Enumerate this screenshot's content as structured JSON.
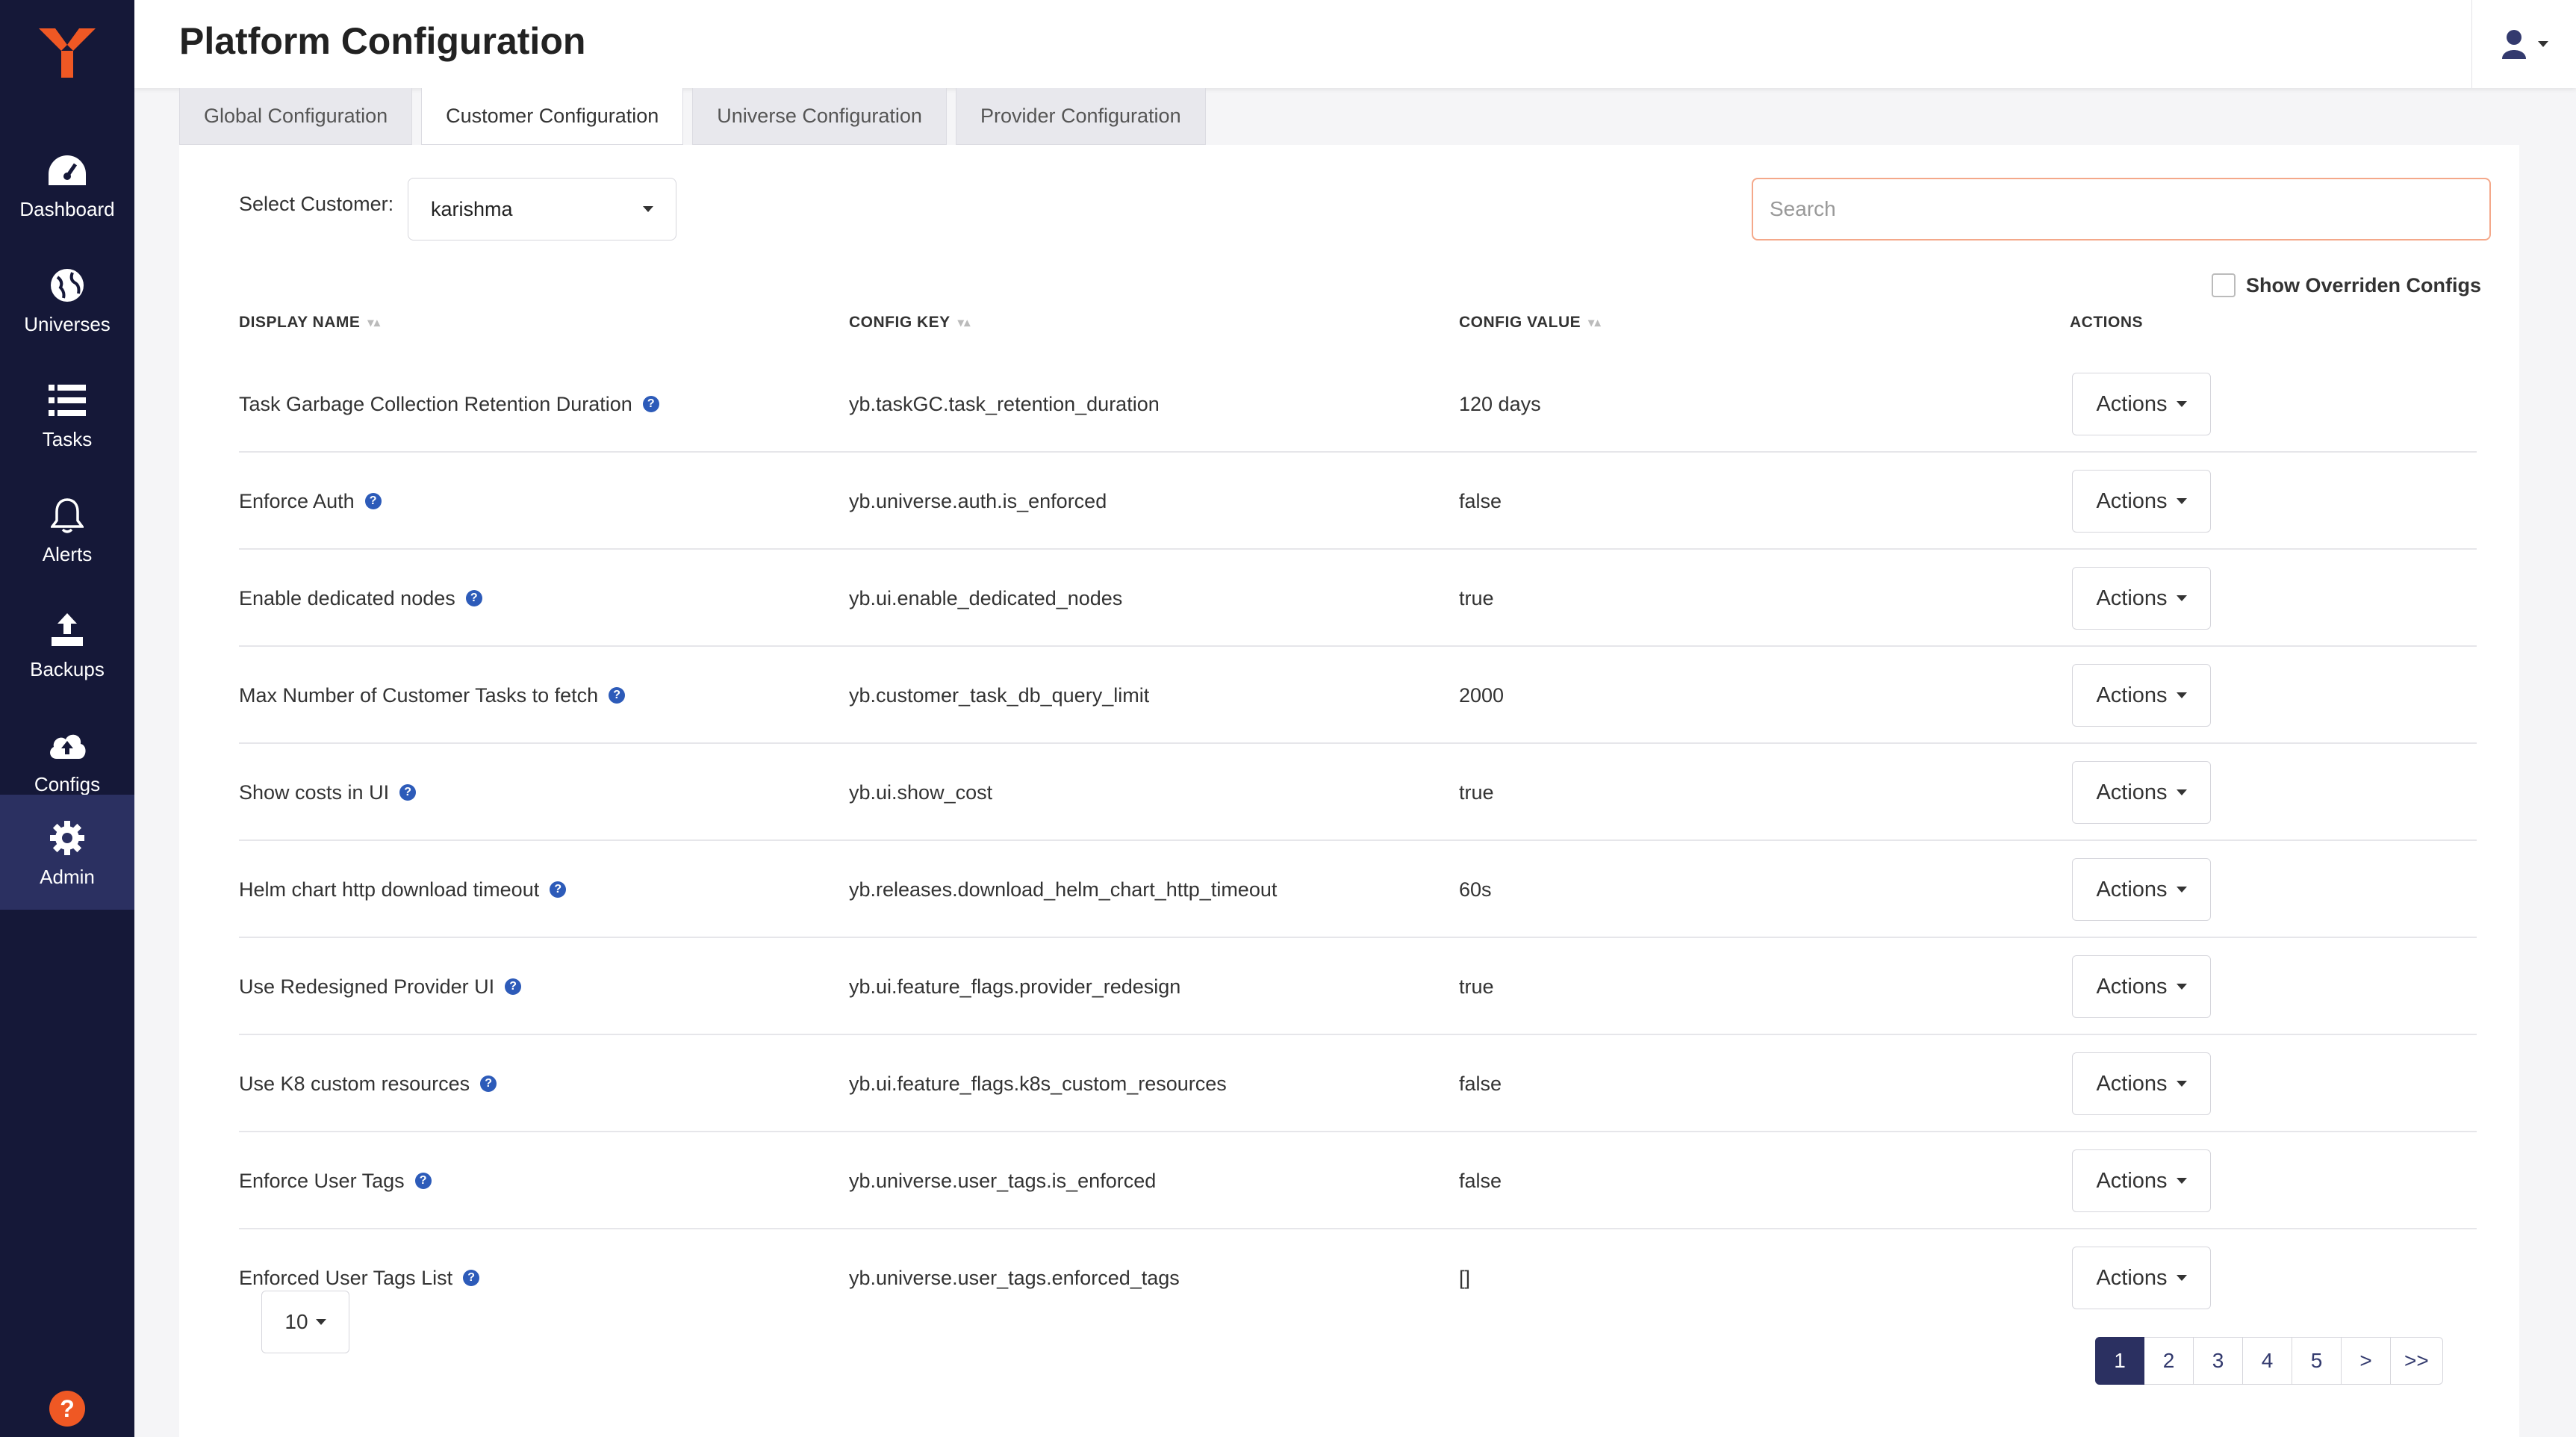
{
  "header": {
    "title": "Platform Configuration"
  },
  "sidebar": {
    "items": [
      {
        "label": "Dashboard",
        "icon": "dashboard-icon"
      },
      {
        "label": "Universes",
        "icon": "globe-icon"
      },
      {
        "label": "Tasks",
        "icon": "list-icon"
      },
      {
        "label": "Alerts",
        "icon": "bell-icon"
      },
      {
        "label": "Backups",
        "icon": "upload-icon"
      },
      {
        "label": "Configs",
        "icon": "cloud-upload-icon"
      },
      {
        "label": "Admin",
        "icon": "gear-icon",
        "active": true
      }
    ],
    "help_glyph": "?"
  },
  "tabs": [
    {
      "label": "Global Configuration"
    },
    {
      "label": "Customer Configuration",
      "active": true
    },
    {
      "label": "Universe Configuration"
    },
    {
      "label": "Provider Configuration"
    }
  ],
  "filters": {
    "customer_label": "Select Customer:",
    "customer_value": "karishma",
    "search_placeholder": "Search",
    "show_overridden_label": "Show Overriden Configs"
  },
  "table": {
    "columns": [
      "DISPLAY NAME",
      "CONFIG KEY",
      "CONFIG VALUE",
      "ACTIONS"
    ],
    "action_label": "Actions",
    "rows": [
      {
        "name": "Task Garbage Collection Retention Duration",
        "key": "yb.taskGC.task_retention_duration",
        "value": "120 days"
      },
      {
        "name": "Enforce Auth",
        "key": "yb.universe.auth.is_enforced",
        "value": "false"
      },
      {
        "name": "Enable dedicated nodes",
        "key": "yb.ui.enable_dedicated_nodes",
        "value": "true"
      },
      {
        "name": "Max Number of Customer Tasks to fetch",
        "key": "yb.customer_task_db_query_limit",
        "value": "2000"
      },
      {
        "name": "Show costs in UI",
        "key": "yb.ui.show_cost",
        "value": "true"
      },
      {
        "name": "Helm chart http download timeout",
        "key": "yb.releases.download_helm_chart_http_timeout",
        "value": "60s"
      },
      {
        "name": "Use Redesigned Provider UI",
        "key": "yb.ui.feature_flags.provider_redesign",
        "value": "true"
      },
      {
        "name": "Use K8 custom resources",
        "key": "yb.ui.feature_flags.k8s_custom_resources",
        "value": "false"
      },
      {
        "name": "Enforce User Tags",
        "key": "yb.universe.user_tags.is_enforced",
        "value": "false"
      },
      {
        "name": "Enforced User Tags List",
        "key": "yb.universe.user_tags.enforced_tags",
        "value": "[]"
      }
    ]
  },
  "pagination": {
    "page_size": "10",
    "pages": [
      "1",
      "2",
      "3",
      "4",
      "5",
      ">",
      ">>"
    ],
    "current": "1"
  },
  "colors": {
    "sidebar_bg": "#151838",
    "sidebar_active": "#2b3061",
    "brand_orange": "#ef5824",
    "info_blue": "#2d5bb9"
  }
}
